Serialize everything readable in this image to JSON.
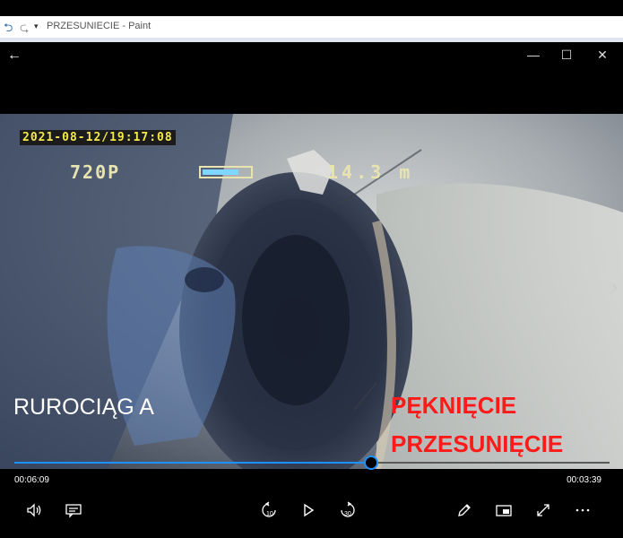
{
  "paint": {
    "title": "PRZESUNIECIE - Paint",
    "quick_access": "▾"
  },
  "video": {
    "osd_datetime": "2021-08-12/19:17:08",
    "osd_resolution": "720P",
    "osd_distance": "14.3 m",
    "label_pipeline": "RUROCIĄG A",
    "label_defect_1": "PĘKNIĘCIE",
    "label_defect_2": "PRZESUNIĘCIE"
  },
  "player": {
    "elapsed": "00:06:09",
    "remaining": "00:03:39",
    "progress_fraction": 0.6,
    "skip_back_label": "10",
    "skip_forward_label": "30",
    "accent": "#1e90ff"
  },
  "icons": {
    "back": "back-arrow-icon",
    "minimize": "minimize-icon",
    "maximize": "maximize-icon",
    "close": "close-icon",
    "volume": "volume-icon",
    "subtitles": "subtitles-icon",
    "skip_back": "skip-back-10-icon",
    "play": "play-icon",
    "skip_forward": "skip-forward-30-icon",
    "edit": "pen-icon",
    "mini_view": "mini-view-icon",
    "fullscreen": "fullscreen-icon",
    "more": "more-icon"
  }
}
